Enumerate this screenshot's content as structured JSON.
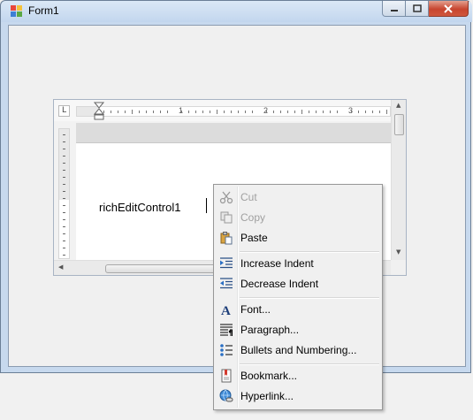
{
  "window": {
    "title": "Form1"
  },
  "ruler": {
    "corner_glyph": "L",
    "numbers": [
      "1",
      "2",
      "3"
    ]
  },
  "editor": {
    "text": "richEditControl1"
  },
  "context_menu": {
    "items": [
      {
        "label": "Cut",
        "icon": "scissors-icon",
        "enabled": false
      },
      {
        "label": "Copy",
        "icon": "copy-icon",
        "enabled": false
      },
      {
        "label": "Paste",
        "icon": "paste-icon",
        "enabled": true
      },
      {
        "label": "Increase Indent",
        "icon": "increase-indent-icon",
        "enabled": true
      },
      {
        "label": "Decrease Indent",
        "icon": "decrease-indent-icon",
        "enabled": true
      },
      {
        "label": "Font...",
        "icon": "font-icon",
        "enabled": true
      },
      {
        "label": "Paragraph...",
        "icon": "paragraph-icon",
        "enabled": true
      },
      {
        "label": "Bullets and Numbering...",
        "icon": "bullets-icon",
        "enabled": true
      },
      {
        "label": "Bookmark...",
        "icon": "bookmark-icon",
        "enabled": true
      },
      {
        "label": "Hyperlink...",
        "icon": "hyperlink-icon",
        "enabled": true
      }
    ]
  },
  "colors": {
    "close_button": "#c7452f",
    "title_bar": "#c2d6ee",
    "menu_bg": "#f0f0f0"
  }
}
